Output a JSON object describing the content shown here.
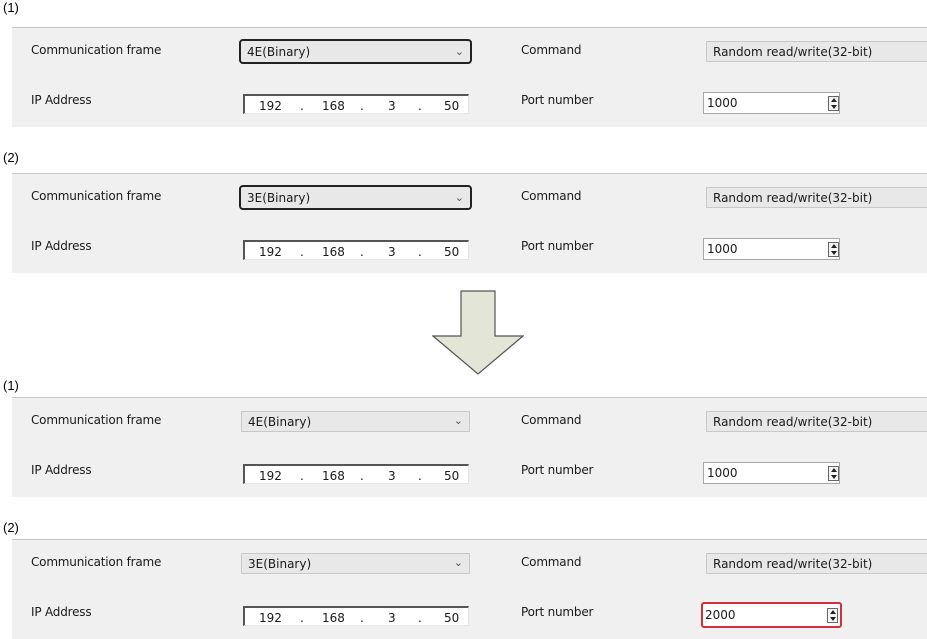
{
  "labels": {
    "communication_frame": "Communication frame",
    "command": "Command",
    "ip_address": "IP Address",
    "port_number": "Port number"
  },
  "panels": [
    {
      "tag": "(1)",
      "frame": "4E(Binary)",
      "command": "Random read/write(32-bit)",
      "ip": [
        "192",
        "168",
        "3",
        "50"
      ],
      "port": "1000"
    },
    {
      "tag": "(2)",
      "frame": "3E(Binary)",
      "command": "Random read/write(32-bit)",
      "ip": [
        "192",
        "168",
        "3",
        "50"
      ],
      "port": "1000"
    },
    {
      "tag": "(1)",
      "frame": "4E(Binary)",
      "command": "Random read/write(32-bit)",
      "ip": [
        "192",
        "168",
        "3",
        "50"
      ],
      "port": "1000"
    },
    {
      "tag": "(2)",
      "frame": "3E(Binary)",
      "command": "Random read/write(32-bit)",
      "ip": [
        "192",
        "168",
        "3",
        "50"
      ],
      "port": "2000"
    }
  ],
  "ip_separator": ".",
  "icons": {
    "dropdown": "chevron-down-icon",
    "spinner": "spin-updown-icon",
    "transition": "arrow-down-icon"
  },
  "colors": {
    "highlight_frame": "#222222",
    "highlight_port": "#d0303c",
    "arrow_fill": "#e3e6d6"
  }
}
